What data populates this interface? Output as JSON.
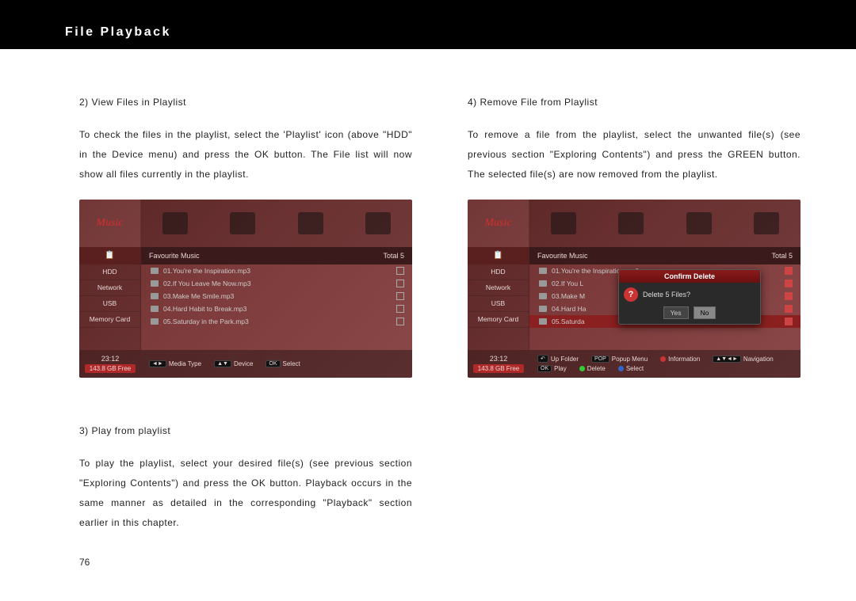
{
  "header": {
    "title": "File Playback"
  },
  "left": {
    "sec2": {
      "heading": "2) View Files in Playlist",
      "body": "To check the files in the playlist, select the 'Playlist' icon (above \"HDD\" in the Device menu) and press the OK button.  The File list will now show all files currently in the playlist."
    },
    "sec3": {
      "heading": "3) Play from playlist",
      "body": "To play the playlist, select your desired file(s) (see previous section \"Exploring Contents\") and press the OK button.  Playback occurs in the same manner as detailed in the corresponding \"Playback\" section earlier in this chapter."
    },
    "pagenum": "76"
  },
  "right": {
    "sec4": {
      "heading": "4) Remove File from Playlist",
      "body": "To remove a file from the playlist, select the unwanted file(s) (see previous section \"Exploring Contents\") and press the GREEN button. The selected file(s) are now removed from the playlist."
    }
  },
  "screenshot1": {
    "music_label": "Music",
    "sidebar": [
      "HDD",
      "Network",
      "USB",
      "Memory Card"
    ],
    "list_title": "Favourite Music",
    "total": "Total 5",
    "files": [
      "01.You're the Inspiration.mp3",
      "02.If You Leave Me Now.mp3",
      "03.Make Me Smile.mp3",
      "04.Hard Habit to Break.mp3",
      "05.Saturday in the Park.mp3"
    ],
    "time": "23:12",
    "free": "143.8 GB Free",
    "legend": [
      {
        "key": "◄►",
        "label": "Media Type"
      },
      {
        "key": "▲▼",
        "label": "Device"
      },
      {
        "key": "OK",
        "label": "Select"
      }
    ]
  },
  "screenshot2": {
    "music_label": "Music",
    "sidebar": [
      "HDD",
      "Network",
      "USB",
      "Memory Card"
    ],
    "list_title": "Favourite Music",
    "total": "Total 5",
    "files": [
      "01.You're the Inspiration.mp3",
      "02.If You L",
      "03.Make M",
      "04.Hard Ha",
      "05.Saturda"
    ],
    "time": "23:12",
    "free": "143.8 GB Free",
    "legend_rows": {
      "row1": {
        "up": "Up Folder",
        "popup": "Popup Menu",
        "info": "Information",
        "nav": "Navigation"
      },
      "row2": {
        "play": "Play",
        "delete": "Delete",
        "select": "Select"
      }
    },
    "dialog": {
      "title": "Confirm Delete",
      "message": "Delete 5 Files?",
      "yes": "Yes",
      "no": "No"
    }
  }
}
